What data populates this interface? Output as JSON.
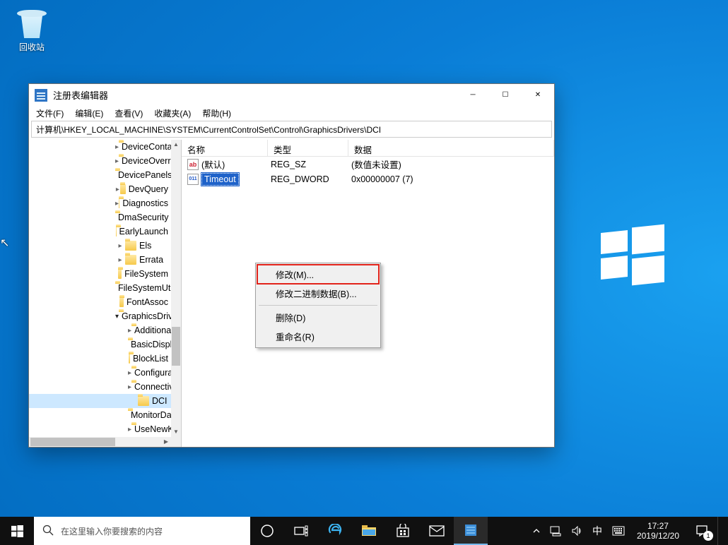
{
  "desktop": {
    "recycle_label": "回收站"
  },
  "window": {
    "title": "注册表编辑器",
    "menu": [
      "文件(F)",
      "编辑(E)",
      "查看(V)",
      "收藏夹(A)",
      "帮助(H)"
    ],
    "address": "计算机\\HKEY_LOCAL_MACHINE\\SYSTEM\\CurrentControlSet\\Control\\GraphicsDrivers\\DCI"
  },
  "tree": [
    {
      "lvl": 3,
      "arrow": "▸",
      "label": "DeviceContai"
    },
    {
      "lvl": 3,
      "arrow": "▸",
      "label": "DeviceOverri"
    },
    {
      "lvl": 3,
      "arrow": "",
      "label": "DevicePanels"
    },
    {
      "lvl": 3,
      "arrow": "▸",
      "label": "DevQuery"
    },
    {
      "lvl": 3,
      "arrow": "▸",
      "label": "Diagnostics"
    },
    {
      "lvl": 3,
      "arrow": "",
      "label": "DmaSecurity"
    },
    {
      "lvl": 3,
      "arrow": "",
      "label": "EarlyLaunch"
    },
    {
      "lvl": 3,
      "arrow": "▸",
      "label": "Els"
    },
    {
      "lvl": 3,
      "arrow": "▸",
      "label": "Errata"
    },
    {
      "lvl": 3,
      "arrow": "",
      "label": "FileSystem"
    },
    {
      "lvl": 3,
      "arrow": "",
      "label": "FileSystemUti"
    },
    {
      "lvl": 3,
      "arrow": "",
      "label": "FontAssoc"
    },
    {
      "lvl": 3,
      "arrow": "▾",
      "label": "GraphicsDriv",
      "expanded": true
    },
    {
      "lvl": 4,
      "arrow": "▸",
      "label": "Additional"
    },
    {
      "lvl": 4,
      "arrow": "",
      "label": "BasicDispl"
    },
    {
      "lvl": 4,
      "arrow": "",
      "label": "BlockList"
    },
    {
      "lvl": 4,
      "arrow": "▸",
      "label": "Configurat"
    },
    {
      "lvl": 4,
      "arrow": "▸",
      "label": "Connectivi"
    },
    {
      "lvl": 4,
      "arrow": "",
      "label": "DCI",
      "selected": true
    },
    {
      "lvl": 4,
      "arrow": "",
      "label": "MonitorDa"
    },
    {
      "lvl": 4,
      "arrow": "▸",
      "label": "UseNewKe"
    }
  ],
  "list": {
    "headers": {
      "name": "名称",
      "type": "类型",
      "data": "数据"
    },
    "rows": [
      {
        "icon": "sz",
        "iconText": "ab",
        "name": "(默认)",
        "type": "REG_SZ",
        "data": "(数值未设置)"
      },
      {
        "icon": "dw",
        "iconText": "011",
        "name": "Timeout",
        "type": "REG_DWORD",
        "data": "0x00000007 (7)",
        "selected": true
      }
    ]
  },
  "context_menu": [
    {
      "label": "修改(M)...",
      "highlight": true
    },
    {
      "label": "修改二进制数据(B)..."
    },
    {
      "sep": true
    },
    {
      "label": "删除(D)"
    },
    {
      "label": "重命名(R)"
    }
  ],
  "taskbar": {
    "search_placeholder": "在这里输入你要搜索的内容",
    "ime": "中",
    "time": "17:27",
    "date": "2019/12/20",
    "notif_count": "1"
  }
}
